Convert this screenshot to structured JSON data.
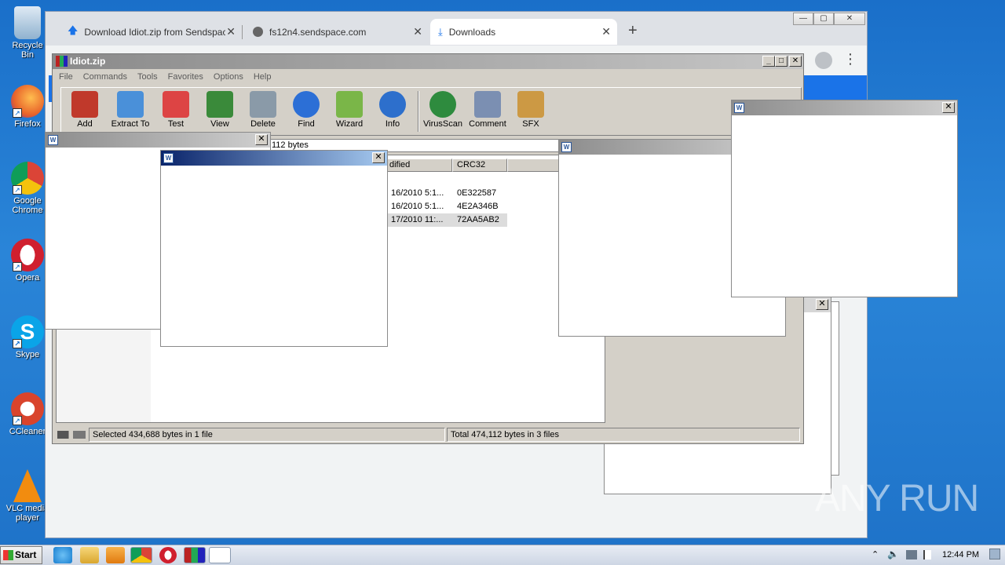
{
  "desktop": {
    "icons": [
      {
        "label": "Recycle Bin",
        "color": "#7ab0d8"
      },
      {
        "label": "Firefox",
        "color": "#e8632a"
      },
      {
        "label": "Google Chrome",
        "color": "#2f9e44"
      },
      {
        "label": "Opera",
        "color": "#d01f2e"
      },
      {
        "label": "Skype",
        "color": "#0aa4e8"
      },
      {
        "label": "CCleaner",
        "color": "#d9442c"
      },
      {
        "label": "VLC media player",
        "color": "#f28c0f"
      }
    ]
  },
  "browser": {
    "tabs": [
      {
        "title": "Download Idiot.zip from Sendspace.c",
        "icon": "upload-arrow-icon"
      },
      {
        "title": "fs12n4.sendspace.com",
        "icon": "globe-icon"
      },
      {
        "title": "Downloads",
        "icon": "download-icon"
      }
    ],
    "new_tab": "+",
    "controls": {
      "minimize": "—",
      "maximize": "▢",
      "close": "✕"
    },
    "menu_dots": "⋮"
  },
  "winrar": {
    "title": "Idiot.zip",
    "menu": [
      "File",
      "Commands",
      "Tools",
      "Favorites",
      "Options",
      "Help"
    ],
    "toolbar": [
      {
        "label": "Add",
        "color": "#c0392b"
      },
      {
        "label": "Extract To",
        "color": "#4a90d9"
      },
      {
        "label": "Test",
        "color": "#d44"
      },
      {
        "label": "View",
        "color": "#3a8a3a"
      },
      {
        "label": "Delete",
        "color": "#8a9aa8"
      },
      {
        "label": "Find",
        "color": "#2c6fd6"
      },
      {
        "label": "Wizard",
        "color": "#7ab648"
      },
      {
        "label": "Info",
        "color": "#2d6fcc"
      },
      {
        "label": "VirusScan",
        "color": "#2e8b3e"
      },
      {
        "label": "Comment",
        "color": "#7b8fb2"
      },
      {
        "label": "SFX",
        "color": "#c94"
      }
    ],
    "path_fragment": "112 bytes",
    "columns": {
      "modified": "dified",
      "crc": "CRC32"
    },
    "rows": [
      {
        "modified": "16/2010 5:1...",
        "crc": "0E322587"
      },
      {
        "modified": "16/2010 5:1...",
        "crc": "4E2A346B"
      },
      {
        "modified": "17/2010 11:...",
        "crc": "72AA5AB2"
      }
    ],
    "status": {
      "selected": "Selected 434,688 bytes in 1 file",
      "total": "Total 474,112 bytes in 3 files"
    }
  },
  "popup_icon_label": "W",
  "popup_close": "✕",
  "watermark": "ANY RUN",
  "taskbar": {
    "start": "Start",
    "clock": "12:44 PM"
  }
}
